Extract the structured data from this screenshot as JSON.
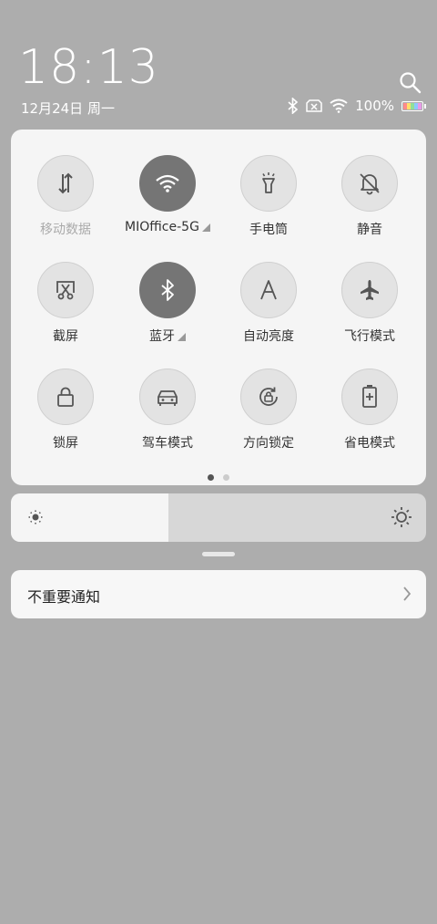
{
  "status": {
    "time": "18:13",
    "date": "12月24日 周一",
    "battery_text": "100%",
    "icons": [
      "bluetooth-icon",
      "no-sim-icon",
      "wifi-icon",
      "battery-icon"
    ]
  },
  "tiles": [
    {
      "label": "移动数据",
      "icon": "mobile-data-icon",
      "state": "disabled"
    },
    {
      "label": "MIOffice-5G",
      "icon": "wifi-icon",
      "state": "on"
    },
    {
      "label": "手电筒",
      "icon": "flashlight-icon",
      "state": "off"
    },
    {
      "label": "静音",
      "icon": "mute-icon",
      "state": "off"
    },
    {
      "label": "截屏",
      "icon": "screenshot-icon",
      "state": "off"
    },
    {
      "label": "蓝牙",
      "icon": "bluetooth-icon",
      "state": "on"
    },
    {
      "label": "自动亮度",
      "icon": "auto-brightness-icon",
      "state": "off"
    },
    {
      "label": "飞行模式",
      "icon": "airplane-icon",
      "state": "off"
    },
    {
      "label": "锁屏",
      "icon": "lock-icon",
      "state": "off"
    },
    {
      "label": "驾车模式",
      "icon": "car-icon",
      "state": "off"
    },
    {
      "label": "方向锁定",
      "icon": "rotation-lock-icon",
      "state": "off"
    },
    {
      "label": "省电模式",
      "icon": "battery-saver-icon",
      "state": "off"
    }
  ],
  "page_indicator": {
    "pages": 2,
    "current": 1
  },
  "brightness": {
    "level": 0.38
  },
  "notification": {
    "label": "不重要通知"
  }
}
